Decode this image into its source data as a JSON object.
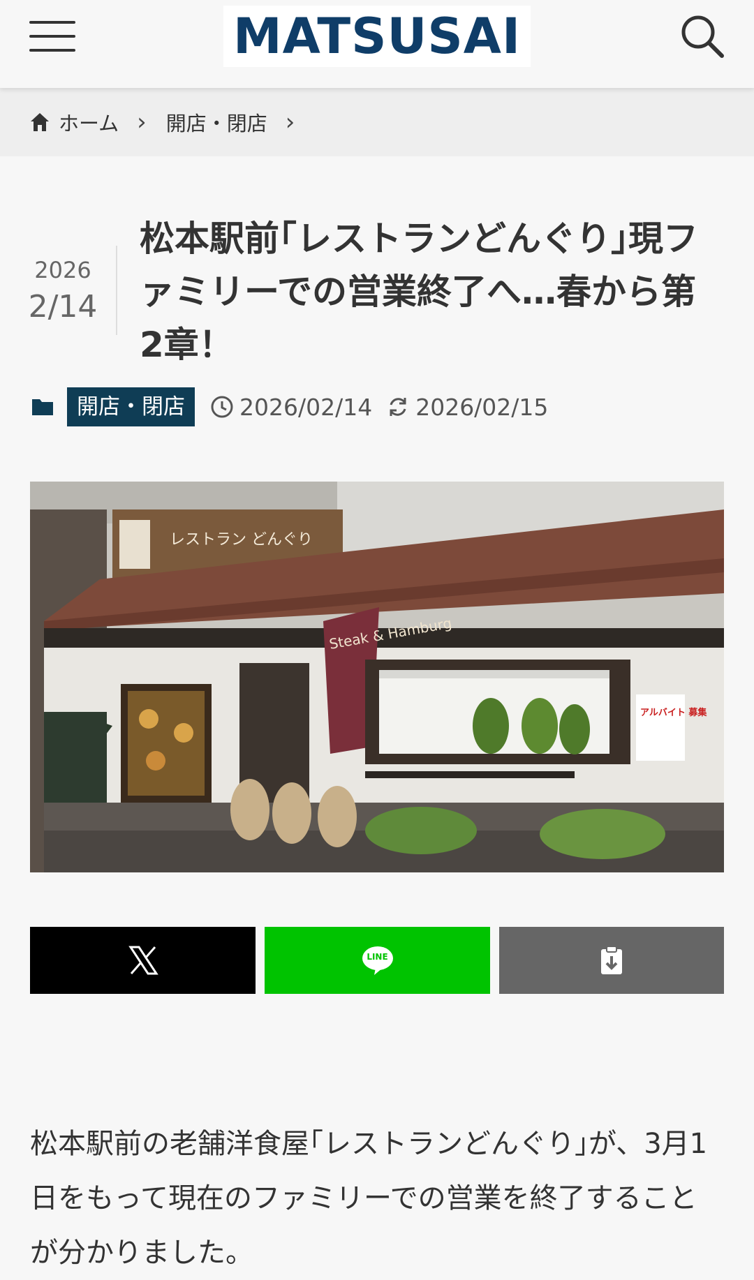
{
  "header": {
    "logo_text": "MATSUSAI",
    "menu_icon": "hamburger-menu-icon",
    "search_icon": "search-icon",
    "logo_color": "#0f3d68"
  },
  "breadcrumb": {
    "home_label": "ホーム",
    "category_label": "開店・閉店"
  },
  "article": {
    "date_year": "2026",
    "date_month_day": "2/14",
    "title": "松本駅前｢レストランどんぐり｣現ファミリーでの営業終了へ…春から第2章！",
    "category_badge": "開店・閉店",
    "published": "2026/02/14",
    "updated": "2026/02/15",
    "badge_color": "#0f3d55",
    "hero_sign_text": "レストラン どんぐり",
    "hero_banner_text": "Steak & Hamburg",
    "hero_notice_text": "アルバイト 募集",
    "body_paragraph": "松本駅前の老舗洋食屋｢レストランどんぐり｣が、3月1日をもって現在のファミリーでの営業を終了することが分かりました。"
  },
  "share": {
    "x_icon": "x-logo-icon",
    "line_icon": "line-logo-icon",
    "line_label": "LINE",
    "copy_icon": "clipboard-icon",
    "x_color": "#000000",
    "line_color": "#00c300",
    "copy_color": "#666666"
  }
}
